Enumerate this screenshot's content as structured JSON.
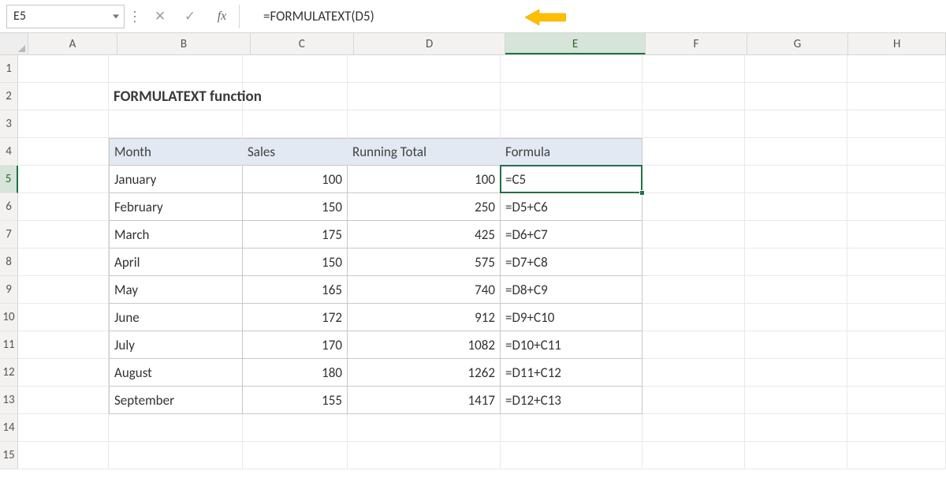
{
  "formula_bar": {
    "active_cell": "E5",
    "formula": "=FORMULATEXT(D5)",
    "cancel_icon": "✕",
    "confirm_icon": "✓",
    "fx_label": "fx",
    "sep_glyph": "⋮"
  },
  "columns": [
    "A",
    "B",
    "C",
    "D",
    "E",
    "F",
    "G",
    "H"
  ],
  "rows": [
    "1",
    "2",
    "3",
    "4",
    "5",
    "6",
    "7",
    "8",
    "9",
    "10",
    "11",
    "12",
    "13",
    "14",
    "15"
  ],
  "selected": {
    "col": "E",
    "row": "5"
  },
  "title": "FORMULATEXT function",
  "headers": {
    "month": "Month",
    "sales": "Sales",
    "running": "Running Total",
    "formula": "Formula"
  },
  "table": [
    {
      "month": "January",
      "sales": "100",
      "running": "100",
      "formula": "=C5"
    },
    {
      "month": "February",
      "sales": "150",
      "running": "250",
      "formula": "=D5+C6"
    },
    {
      "month": "March",
      "sales": "175",
      "running": "425",
      "formula": "=D6+C7"
    },
    {
      "month": "April",
      "sales": "150",
      "running": "575",
      "formula": "=D7+C8"
    },
    {
      "month": "May",
      "sales": "165",
      "running": "740",
      "formula": "=D8+C9"
    },
    {
      "month": "June",
      "sales": "172",
      "running": "912",
      "formula": "=D9+C10"
    },
    {
      "month": "July",
      "sales": "170",
      "running": "1082",
      "formula": "=D10+C11"
    },
    {
      "month": "August",
      "sales": "180",
      "running": "1262",
      "formula": "=D11+C12"
    },
    {
      "month": "September",
      "sales": "155",
      "running": "1417",
      "formula": "=D12+C13"
    }
  ],
  "chart_data": {
    "type": "table",
    "title": "FORMULATEXT function",
    "columns": [
      "Month",
      "Sales",
      "Running Total",
      "Formula"
    ],
    "rows": [
      [
        "January",
        100,
        100,
        "=C5"
      ],
      [
        "February",
        150,
        250,
        "=D5+C6"
      ],
      [
        "March",
        175,
        425,
        "=D6+C7"
      ],
      [
        "April",
        150,
        575,
        "=D7+C8"
      ],
      [
        "May",
        165,
        740,
        "=D8+C9"
      ],
      [
        "June",
        172,
        912,
        "=D9+C10"
      ],
      [
        "July",
        170,
        1082,
        "=D10+C11"
      ],
      [
        "August",
        180,
        1262,
        "=D11+C12"
      ],
      [
        "September",
        155,
        1417,
        "=D12+C13"
      ]
    ]
  }
}
